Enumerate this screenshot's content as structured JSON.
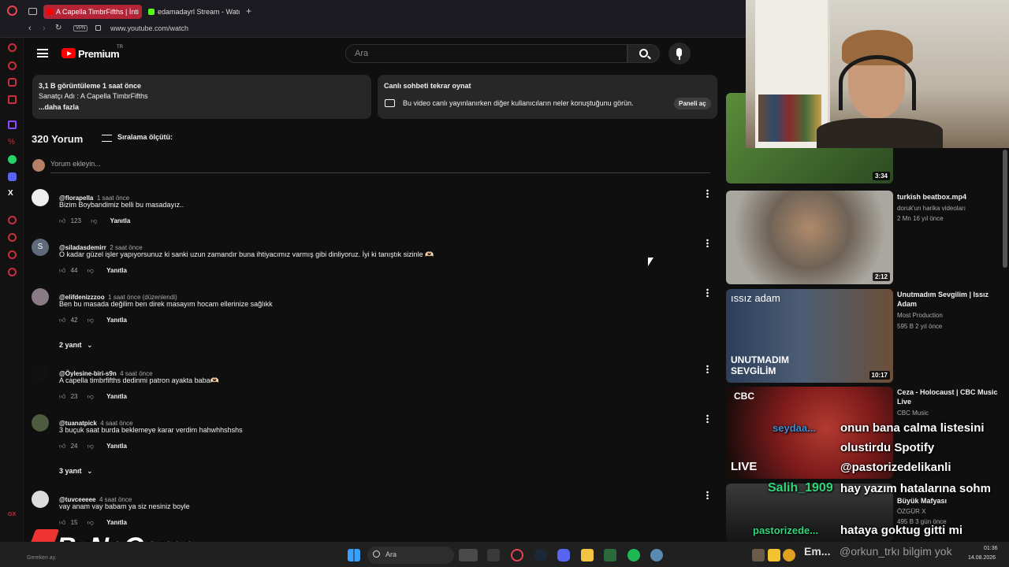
{
  "browser": {
    "tabs": [
      {
        "label": "A Capella TimbrFifths | İnti",
        "active": true
      },
      {
        "label": "edamadayrl Stream - Watc",
        "active": false
      }
    ],
    "new_tab": "+",
    "vpn_badge": "VPN",
    "url": "www.youtube.com/watch"
  },
  "header": {
    "logo_label": "Premium",
    "logo_region": "TR",
    "search_placeholder": "Ara"
  },
  "description": {
    "views_time": "3,1 B görüntüleme  1 saat önce",
    "artist": "Sanatçı Adı : A Capella TimbrFifths",
    "more": "...daha fazla"
  },
  "chat_replay": {
    "title": "Canlı sohbeti tekrar oynat",
    "desc": "Bu video canlı yayınlanırken diğer kullanıcıların neler konuştuğunu görün.",
    "button": "Paneli aç"
  },
  "comments_header": {
    "count": "320 Yorum",
    "sort": "Sıralama ölçütü:",
    "add_placeholder": "Yorum ekleyin..."
  },
  "comments": [
    {
      "user": "@florapella",
      "time": "1 saat önce",
      "text": "Bizim Boybandimiz belli bu masadayız..",
      "likes": "123",
      "reply": "Yanıtla",
      "replies": ""
    },
    {
      "user": "@siladasdemirr",
      "time": "2 saat önce",
      "text": "O kadar güzel işler yapıyorsunuz ki sanki uzun zamandır buna ihtiyacımız varmış gibi dinliyoruz. İyi ki tanıştık sizinle 🫶🏻",
      "likes": "44",
      "reply": "Yanıtla",
      "replies": "",
      "initial": "S"
    },
    {
      "user": "@elifdenizzzoo",
      "time": "1 saat önce (düzenlendi)",
      "text": "Ben bu masada değilim ben direk masayım hocam ellerinize sağlıkk",
      "likes": "42",
      "reply": "Yanıtla",
      "replies": "2 yanıt"
    },
    {
      "user": "@Öylesine-biri-s9n",
      "time": "4 saat önce",
      "text": "A capella timbrfifths dedinmi patron ayakta baba🫶🏻",
      "likes": "23",
      "reply": "Yanıtla",
      "replies": ""
    },
    {
      "user": "@tuanatpick",
      "time": "4 saat önce",
      "text": "3 buçuk saat burda beklemeye karar verdim hahwhhshshs",
      "likes": "24",
      "reply": "Yanıtla",
      "replies": "3 yanıt"
    },
    {
      "user": "@tuvceeeee",
      "time": "4 saat önce",
      "text": "vay anam vay babam ya siz nesiniz boyle",
      "likes": "15",
      "reply": "Yanıtla",
      "replies": ""
    }
  ],
  "related": [
    {
      "title": "",
      "channel": "",
      "meta": "",
      "duration": "3:34"
    },
    {
      "title": "turkish beatbox.mp4",
      "channel": "doruk'un harika videoları",
      "meta": "2 Mn   16 yıl önce",
      "duration": "2:12"
    },
    {
      "title": "Unutmadım Sevgilim | Issız Adam",
      "channel": "Most Production",
      "meta": "595 B   2 yıl önce",
      "duration": "10:17",
      "overlay_top": "ıssız adam",
      "overlay_bottom": "UNUTMADIM SEVGİLİM"
    },
    {
      "title": "Ceza - Holocaust | CBC Music Live",
      "channel": "CBC Music",
      "meta": "",
      "duration": "",
      "overlay_top": "CBC",
      "overlay_bottom": "LIVE"
    },
    {
      "title": "Büyük Mafyası",
      "channel": "ÖZGÜR X",
      "meta": "495 B   3 gün önce",
      "duration": ""
    }
  ],
  "stream_chat": [
    {
      "user": "seydaa...",
      "msg": "onun bana calma listesini"
    },
    {
      "user": "",
      "msg": "olustirdu Spotify"
    },
    {
      "user": "",
      "msg": "@pastorizedelikanli"
    },
    {
      "user": "Salih_1909",
      "msg": "hay yazım hatalarına sohm"
    },
    {
      "user": "pastorizede...",
      "msg": "hataya goktug gitti mi"
    }
  ],
  "watermark": "ByNoGame",
  "watermark_sub": "Gereken ay.",
  "taskbar": {
    "search": "Ara",
    "time": "01:36",
    "date": "14.08.2026",
    "social": "@orkun_trkı bilgim yok",
    "tray_text": "Em..."
  },
  "colors": {
    "yt_red": "#ff0000",
    "accent": "#3ea6ff",
    "chat_user_blue": "#3b8fd6",
    "chat_user_green": "#2fd67a"
  }
}
